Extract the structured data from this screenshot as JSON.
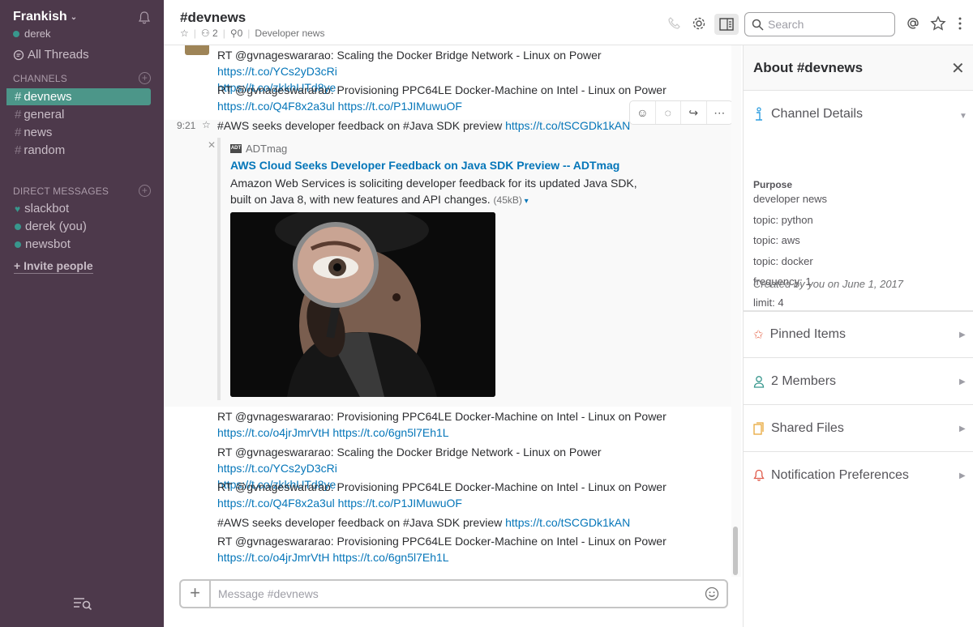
{
  "sidebar": {
    "team_name": "Frankish",
    "user_name": "derek",
    "all_threads": "All Threads",
    "channels_header": "CHANNELS",
    "channels": [
      {
        "name": "devnews",
        "active": true
      },
      {
        "name": "general",
        "active": false
      },
      {
        "name": "news",
        "active": false
      },
      {
        "name": "random",
        "active": false
      }
    ],
    "dm_header": "DIRECT MESSAGES",
    "dms": [
      {
        "name": "slackbot",
        "icon": "heart"
      },
      {
        "name": "derek (you)",
        "icon": "presence-dot"
      },
      {
        "name": "newsbot",
        "icon": "presence-dot"
      }
    ],
    "invite": "+ Invite people",
    "colors": {
      "background": "#4d394b",
      "active": "#4c9689",
      "presence": "#38978d"
    }
  },
  "header": {
    "channel": "#devnews",
    "members_count": "2",
    "pinned_count": "0",
    "topic": "Developer news",
    "search_placeholder": "Search"
  },
  "messages": {
    "first": {
      "text": "RT @gvnageswararao: Scaling the Docker Bridge Network - Linux on Power ",
      "link1": "https://t.co/YCs2yD3cRi",
      "link2": "https://t.co/zkkhUTd8ye"
    },
    "second": {
      "text": "RT @gvnageswararao: Provisioning PPC64LE Docker-Machine on Intel - Linux on Power",
      "link1": "https://t.co/Q4F8x2a3ul",
      "link2": "https://t.co/P1JIMuwuOF"
    },
    "third": {
      "time": "9:21",
      "text": "#AWS seeks developer feedback on #Java SDK preview ",
      "link": "https://t.co/tSCGDk1kAN"
    },
    "attachment": {
      "service_icon": "ADT",
      "service": "ADTmag",
      "title": "AWS Cloud Seeks Developer Feedback on Java SDK Preview -- ADTmag",
      "text": "Amazon Web Services is soliciting developer feedback for its updated Java SDK, built on Java 8, with new features and API changes.",
      "size": "(45kB)"
    },
    "fourth": {
      "text": "RT @gvnageswararao: Provisioning PPC64LE Docker-Machine on Intel - Linux on Power",
      "link1": "https://t.co/o4jrJmrVtH",
      "link2": "https://t.co/6gn5l7Eh1L"
    },
    "fifth": {
      "text": "RT @gvnageswararao: Scaling the Docker Bridge Network - Linux on Power ",
      "link1": "https://t.co/YCs2yD3cRi",
      "link2": "https://t.co/zkkhUTd8ye"
    },
    "sixth": {
      "text": "RT @gvnageswararao: Provisioning PPC64LE Docker-Machine on Intel - Linux on Power",
      "link1": "https://t.co/Q4F8x2a3ul",
      "link2": "https://t.co/P1JIMuwuOF"
    },
    "seventh": {
      "text": "#AWS seeks developer feedback on #Java SDK preview ",
      "link": "https://t.co/tSCGDk1kAN"
    },
    "eighth": {
      "text": "RT @gvnageswararao: Provisioning PPC64LE Docker-Machine on Intel - Linux on Power",
      "link1": "https://t.co/o4jrJmrVtH",
      "link2": "https://t.co/6gn5l7Eh1L"
    }
  },
  "composer": {
    "placeholder": "Message #devnews"
  },
  "panel": {
    "title": "About #devnews",
    "channel_details": "Channel Details",
    "purpose_label": "Purpose",
    "purpose": "developer news",
    "topics": [
      "topic: python",
      "topic: aws",
      "topic: docker",
      "frequency: 1",
      "limit: 4"
    ],
    "created": "Created by you on June 1, 2017",
    "pinned": "Pinned Items",
    "members": "2 Members",
    "files": "Shared Files",
    "notifications": "Notification Preferences"
  }
}
